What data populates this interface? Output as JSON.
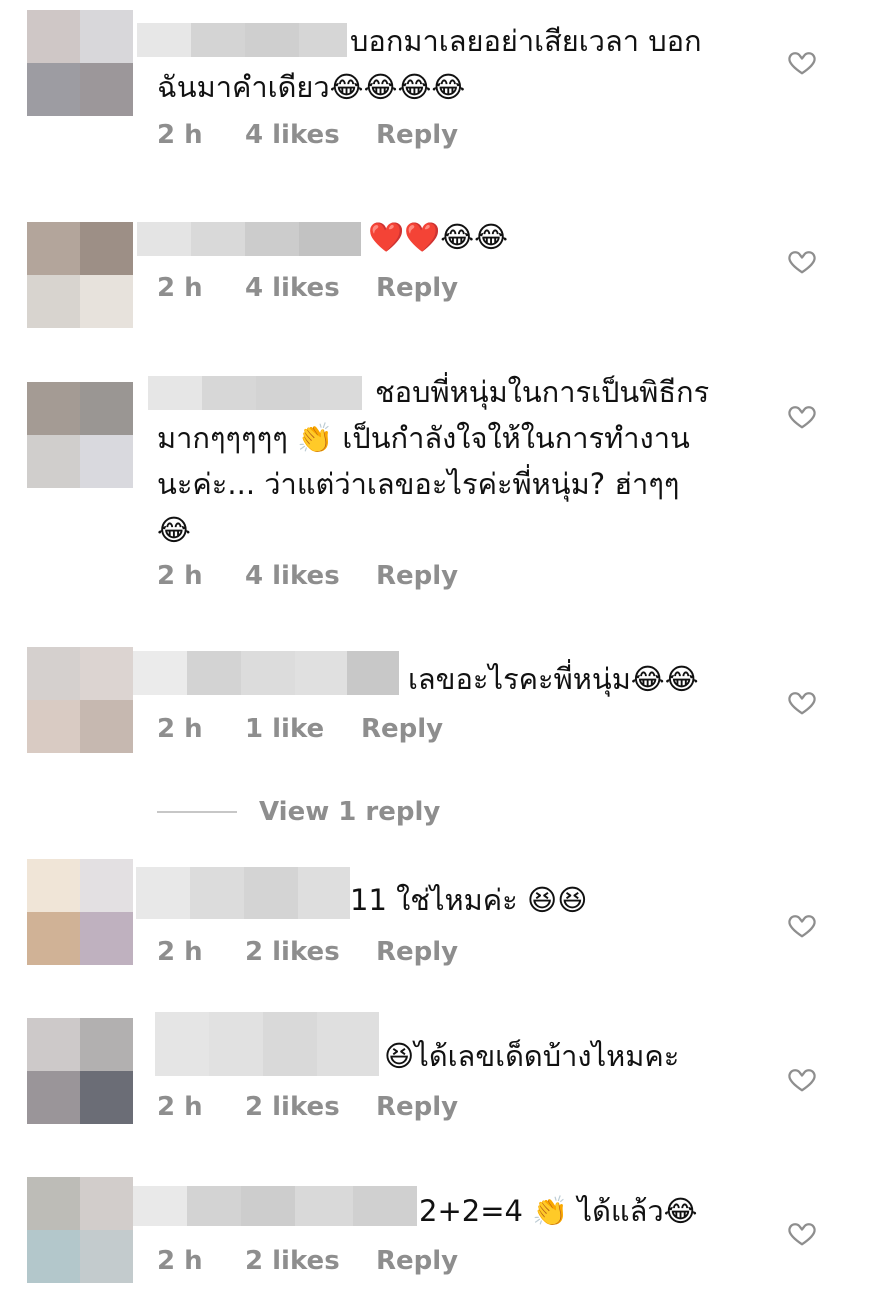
{
  "comments": [
    {
      "text": "บอกมาเลยอย่าเสียเวลา บอก\nฉันมาคำเดียว😂😂😂😂",
      "time": "2 h",
      "likes": "4 likes",
      "reply": "Reply",
      "avatar_colors": [
        "#cfc7c6",
        "#d8d7da",
        "#9d9ca2",
        "#9c979a"
      ],
      "username_colors": [
        "#e7e7e7",
        "#d4d4d4",
        "#cfcfcf",
        "#d6d6d6"
      ]
    },
    {
      "text": "❤️❤️😂😂",
      "time": "2 h",
      "likes": "4 likes",
      "reply": "Reply",
      "avatar_colors": [
        "#b3a59b",
        "#9d8f86",
        "#d8d4cf",
        "#e7e2dc"
      ],
      "username_colors": [
        "#e4e4e4",
        "#d9d9d9",
        "#cccccc",
        "#c2c2c2"
      ]
    },
    {
      "text": "ชอบพี่หนุ่มในการเป็นพิธีกร\nมากๆๆๆๆๆ 👏 เป็นกำลังใจให้ในการทำงาน\nนะค่ะ... ว่าแต่ว่าเลขอะไรค่ะพี่หนุ่ม? ฮ่าๆๆ\n😂",
      "time": "2 h",
      "likes": "4 likes",
      "reply": "Reply",
      "avatar_colors": [
        "#a49b94",
        "#9a9693",
        "#d0cecc",
        "#d9d9de"
      ],
      "username_colors": [
        "#e6e6e6",
        "#d7d7d7",
        "#d3d3d3",
        "#dadada"
      ]
    },
    {
      "text": "เลขอะไรคะพี่หนุ่ม😂😂",
      "time": "2 h",
      "likes": "1 like",
      "reply": "Reply",
      "avatar_colors": [
        "#d5d0ce",
        "#dcd4d1",
        "#d9cbc3",
        "#c6b8b0"
      ],
      "username_colors": [
        "#ebebeb",
        "#d3d3d3",
        "#dcdcdc",
        "#e0e0e0",
        "#c8c8c8"
      ],
      "view_replies": "View 1 reply"
    },
    {
      "text": "11 ใช่ไหมค่ะ 😆😆",
      "time": "2 h",
      "likes": "2 likes",
      "reply": "Reply",
      "avatar_colors": [
        "#f0e5d7",
        "#e3e0e2",
        "#d0b296",
        "#bfb1bf"
      ],
      "username_colors": [
        "#e8e8e8",
        "#dcdcdc",
        "#d4d4d4",
        "#dedede"
      ]
    },
    {
      "text": "😆ได้เลขเด็ดบ้างไหมคะ",
      "time": "2 h",
      "likes": "2 likes",
      "reply": "Reply",
      "avatar_colors": [
        "#cdc9c9",
        "#b2b0b0",
        "#9a9599",
        "#6b6d76"
      ],
      "username_colors": [
        "#e5e5e5",
        "#e1e1e1",
        "#d9d9d9",
        "#dfdfdf"
      ]
    },
    {
      "text": "2+2=4 👏 ได้แล้ว😂",
      "time": "2 h",
      "likes": "2 likes",
      "reply": "Reply",
      "avatar_colors": [
        "#bdbcb7",
        "#d2cdcb",
        "#b3c7cb",
        "#c3cbcd"
      ],
      "username_colors": [
        "#e9e9e9",
        "#d3d3d3",
        "#cdcdcd",
        "#d9d9d9",
        "#d0d0d0"
      ]
    }
  ],
  "colors": {
    "meta": "#8e8e8e",
    "heart_stroke": "#8e8e8e"
  }
}
